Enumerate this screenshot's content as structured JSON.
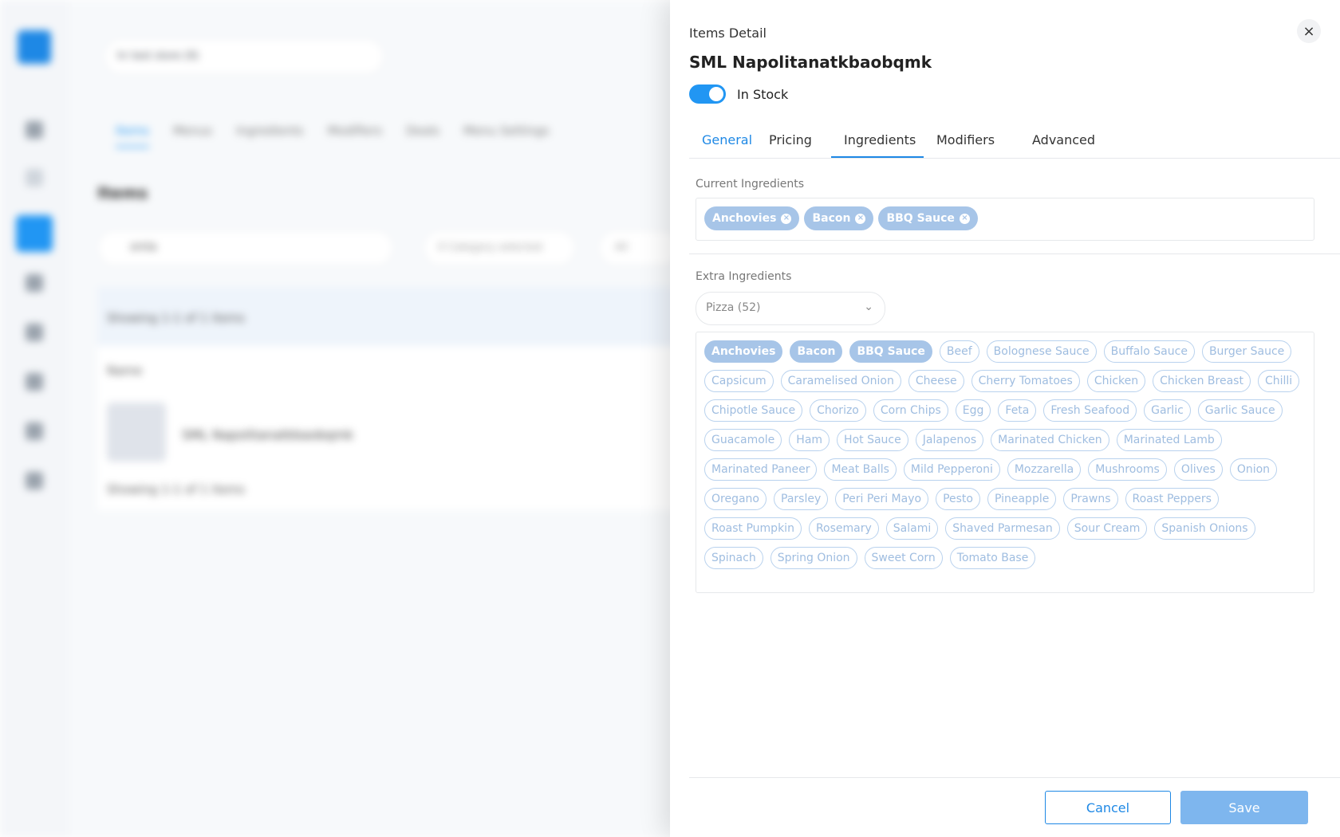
{
  "background": {
    "store_select": "hr test store (9)",
    "tabs": [
      "Items",
      "Menus",
      "Ingredients",
      "Modifiers",
      "Deals",
      "Menu Settings"
    ],
    "title": "Items",
    "search_value": "smla",
    "category_filter": "0 Category selected",
    "filter2": "All",
    "showing": "Showing 1-1 of 1 items",
    "col_name": "Name",
    "row_name": "SML Napolitanatkbaobqmk",
    "showing_footer": "Showing 1-1 of 1 items"
  },
  "drawer": {
    "small_title": "Items Detail",
    "item_name": "SML Napolitanatkbaobqmk",
    "close_icon": "×",
    "in_stock_label": "In Stock",
    "in_stock": true,
    "tabs": [
      "General",
      "Pricing",
      "Ingredients",
      "Modifiers",
      "Advanced"
    ],
    "active_tab": "Ingredients",
    "current_label": "Current Ingredients",
    "current_ingredients": [
      "Anchovies",
      "Bacon",
      "BBQ Sauce"
    ],
    "extra_label": "Extra Ingredients",
    "extra_dropdown": "Pizza (52)",
    "extra_ingredients": [
      "Anchovies",
      "Bacon",
      "BBQ Sauce",
      "Beef",
      "Bolognese Sauce",
      "Buffalo Sauce",
      "Burger Sauce",
      "Capsicum",
      "Caramelised Onion",
      "Cheese",
      "Cherry Tomatoes",
      "Chicken",
      "Chicken Breast",
      "Chilli",
      "Chipotle Sauce",
      "Chorizo",
      "Corn Chips",
      "Egg",
      "Feta",
      "Fresh Seafood",
      "Garlic",
      "Garlic Sauce",
      "Guacamole",
      "Ham",
      "Hot Sauce",
      "Jalapenos",
      "Marinated Chicken",
      "Marinated Lamb",
      "Marinated Paneer",
      "Meat Balls",
      "Mild Pepperoni",
      "Mozzarella",
      "Mushrooms",
      "Olives",
      "Onion",
      "Oregano",
      "Parsley",
      "Peri Peri Mayo",
      "Pesto",
      "Pineapple",
      "Prawns",
      "Roast Peppers",
      "Roast Pumpkin",
      "Rosemary",
      "Salami",
      "Shaved Parmesan",
      "Sour Cream",
      "Spanish Onions",
      "Spinach",
      "Spring Onion",
      "Sweet Corn",
      "Tomato Base"
    ],
    "selected_extras": [
      "Anchovies",
      "Bacon",
      "BBQ Sauce"
    ],
    "cancel_label": "Cancel",
    "save_label": "Save"
  },
  "colors": {
    "accent": "#1e88e5",
    "chip_selected": "#a7c5e8",
    "save_button": "#7eb6ee"
  }
}
